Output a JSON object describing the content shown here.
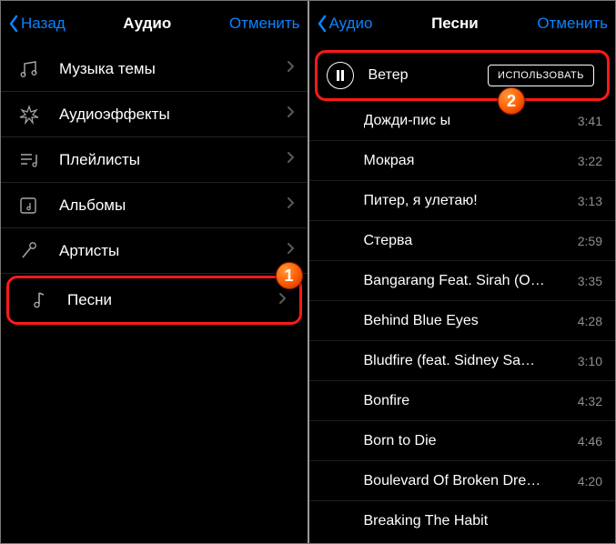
{
  "left": {
    "back_label": "Назад",
    "title": "Аудио",
    "cancel_label": "Отменить",
    "categories": [
      {
        "label": "Музыка темы"
      },
      {
        "label": "Аудиоэффекты"
      },
      {
        "label": "Плейлисты"
      },
      {
        "label": "Альбомы"
      },
      {
        "label": "Артисты"
      },
      {
        "label": "Песни"
      }
    ],
    "callout_number": "1"
  },
  "right": {
    "back_label": "Аудио",
    "title": "Песни",
    "cancel_label": "Отменить",
    "use_label": "ИСПОЛЬЗОВАТЬ",
    "callout_number": "2",
    "songs": [
      {
        "title": "Ветер",
        "duration": ""
      },
      {
        "title": "Дожди-пис            ы",
        "duration": "3:41"
      },
      {
        "title": "Мокрая",
        "duration": "3:22"
      },
      {
        "title": "Питер, я улетаю!",
        "duration": "3:13"
      },
      {
        "title": "Стерва",
        "duration": "2:59"
      },
      {
        "title": "Bangarang Feat. Sirah (O…",
        "duration": "3:35"
      },
      {
        "title": "Behind Blue Eyes",
        "duration": "4:28"
      },
      {
        "title": "Bludfire (feat. Sidney Sa…",
        "duration": "3:10"
      },
      {
        "title": "Bonfire",
        "duration": "4:32"
      },
      {
        "title": "Born to Die",
        "duration": "4:46"
      },
      {
        "title": "Boulevard Of Broken Dre…",
        "duration": "4:20"
      },
      {
        "title": "Breaking The Habit",
        "duration": ""
      }
    ]
  }
}
